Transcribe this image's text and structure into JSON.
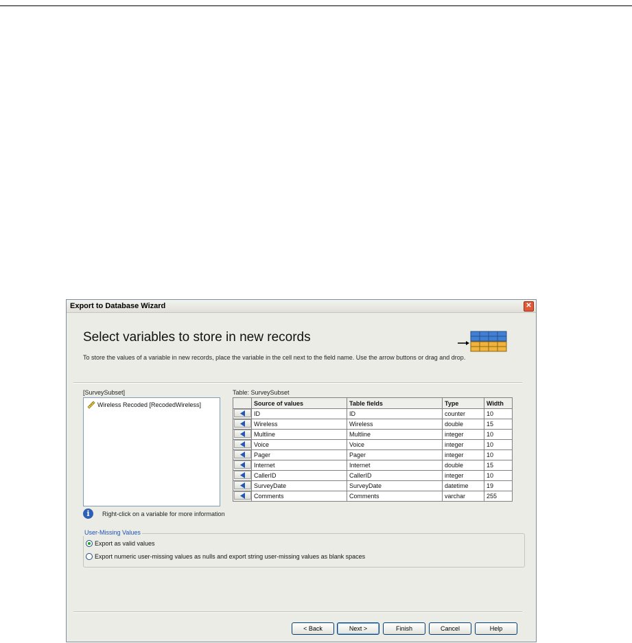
{
  "window": {
    "title": "Export to Database Wizard",
    "close_glyph": "✕"
  },
  "header": {
    "heading": "Select variables to store in new records",
    "instructions": "To store the values of a variable in new records, place the variable in the cell next to the field name. Use the arrow buttons or drag and drop."
  },
  "variables": {
    "label": "[SurveySubset]",
    "items": [
      {
        "label": "Wireless Recoded [RecodedWireless]",
        "icon": "ruler-icon"
      }
    ]
  },
  "info": {
    "icon_glyph": "i",
    "text": "Right-click on a variable for more information"
  },
  "table": {
    "label": "Table: SurveySubset",
    "columns": [
      "Source of values",
      "Table fields",
      "Type",
      "Width"
    ],
    "rows": [
      {
        "source": "ID",
        "field": "ID",
        "type": "counter",
        "width": "10"
      },
      {
        "source": "Wireless",
        "field": "Wireless",
        "type": "double",
        "width": "15"
      },
      {
        "source": "Multline",
        "field": "Multline",
        "type": "integer",
        "width": "10"
      },
      {
        "source": "Voice",
        "field": "Voice",
        "type": "integer",
        "width": "10"
      },
      {
        "source": "Pager",
        "field": "Pager",
        "type": "integer",
        "width": "10"
      },
      {
        "source": "Internet",
        "field": "Internet",
        "type": "double",
        "width": "15"
      },
      {
        "source": "CallerID",
        "field": "CallerID",
        "type": "integer",
        "width": "10"
      },
      {
        "source": "SurveyDate",
        "field": "SurveyDate",
        "type": "datetime",
        "width": "19"
      },
      {
        "source": "Comments",
        "field": "Comments",
        "type": "varchar",
        "width": "255"
      }
    ]
  },
  "missing": {
    "legend": "User-Missing Values",
    "options": [
      {
        "label": "Export as valid values",
        "checked": true
      },
      {
        "label": "Export numeric user-missing values as nulls and export string user-missing values as blank spaces",
        "checked": false
      }
    ]
  },
  "buttons": {
    "back": "< Back",
    "next": "Next >",
    "finish": "Finish",
    "cancel": "Cancel",
    "help": "Help"
  },
  "colors": {
    "accent": "#1f50b5",
    "db_blue": "#3f7fd4",
    "db_orange": "#f0b43c"
  }
}
